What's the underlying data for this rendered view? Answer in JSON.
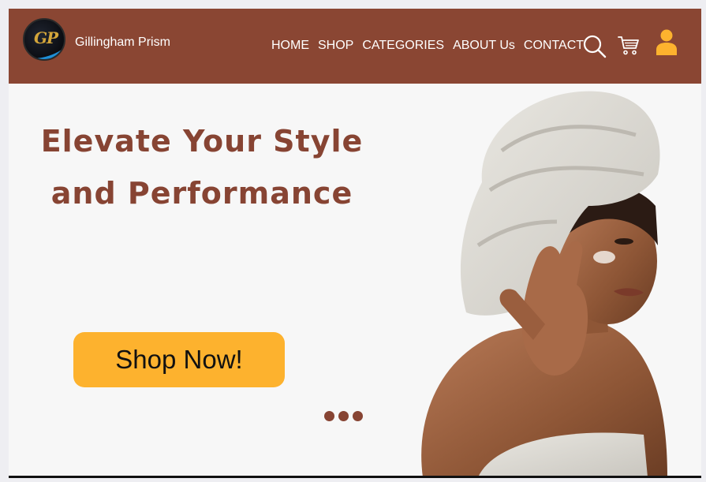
{
  "brand": {
    "initials": "GP",
    "name": "Gillingham Prism"
  },
  "nav": {
    "links": [
      "HOME",
      "SHOP",
      "CATEGORIES",
      "ABOUT Us",
      "CONTACT"
    ]
  },
  "header_icons": [
    "search-icon",
    "cart-icon",
    "user-icon"
  ],
  "hero": {
    "title_line1": "Elevate Your Style",
    "title_line2": "and Performance",
    "cta_label": "Shop Now!",
    "carousel_dots": 3
  },
  "colors": {
    "navbar": "#8a4633",
    "accent_text": "#874433",
    "cta": "#fdb22e",
    "user_icon": "#fdb22e"
  }
}
